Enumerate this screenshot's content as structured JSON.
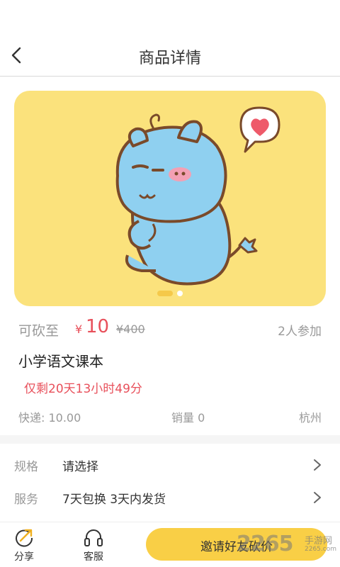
{
  "header": {
    "title": "商品详情"
  },
  "banner": {
    "image_desc_icon": "hippo-illustration",
    "slide_count": 2,
    "active_slide": 1
  },
  "product": {
    "cut_label": "可砍至",
    "currency": "¥",
    "cut_price": "10",
    "original_price": "¥400",
    "participants": "2人参加",
    "name": "小学语文课本",
    "remaining": "仅剩20天13小时49分",
    "shipping": "快递: 10.00",
    "sales": "销量 0",
    "location": "杭州"
  },
  "options": [
    {
      "key": "规格",
      "value": "请选择"
    },
    {
      "key": "服务",
      "value": "7天包换  3天内发货"
    }
  ],
  "bottom": {
    "share_label": "分享",
    "service_label": "客服",
    "invite_label": "邀请好友砍价"
  },
  "watermark": {
    "brand": "2265",
    "cn": "手游网",
    "url": "2265.com"
  },
  "colors": {
    "accent": "#f9cf46",
    "price": "#e8505b",
    "banner_bg": "#fbe27c"
  }
}
